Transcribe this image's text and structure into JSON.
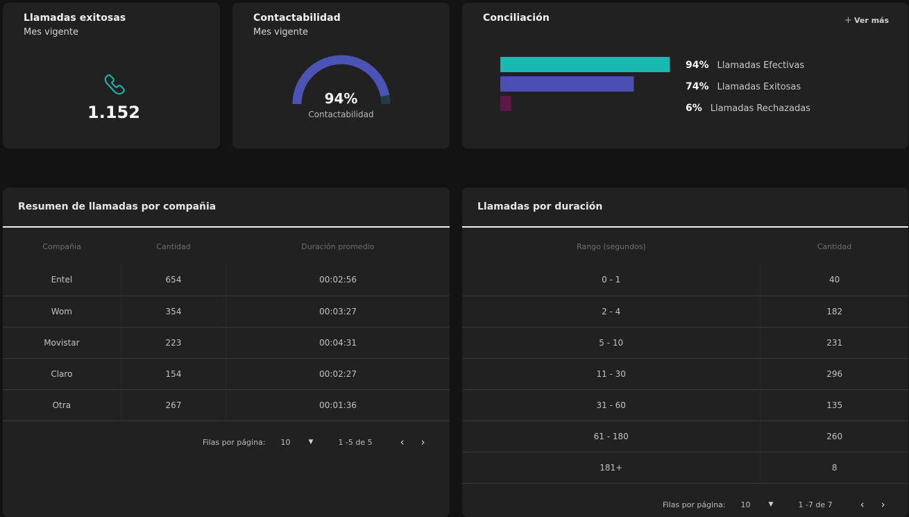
{
  "kpi_calls": {
    "title": "Llamadas exitosas",
    "subtitle": "Mes vigente",
    "icon": "phone-icon",
    "value": "1.152",
    "accent": "#1fb0a8"
  },
  "kpi_contact": {
    "title": "Contactabilidad",
    "subtitle": "Mes vigente",
    "value_text": "94%",
    "value": 94,
    "label": "Contactabilidad",
    "gauge_color": "#4b53b5",
    "gauge_rest_color": "#1e3f49"
  },
  "conciliacion": {
    "title": "Conciliación",
    "ver_mas": "Ver más",
    "items": [
      {
        "value_text": "94%",
        "value": 94,
        "label": "Llamadas Efectivas",
        "color": "#1ab8b0"
      },
      {
        "value_text": "74%",
        "value": 74,
        "label": "Llamadas Exitosas",
        "color": "#4b4fb3"
      },
      {
        "value_text": "6%",
        "value": 6,
        "label": "Llamadas Rechazadas",
        "color": "#5a1a45"
      }
    ]
  },
  "companies": {
    "title": "Resumen de llamadas por compañia",
    "columns": [
      "Compañia",
      "Cantidad",
      "Duración promedio"
    ],
    "rows": [
      [
        "Entel",
        "654",
        "00:02:56"
      ],
      [
        "Wom",
        "354",
        "00:03:27"
      ],
      [
        "Movistar",
        "223",
        "00:04:31"
      ],
      [
        "Claro",
        "154",
        "00:02:27"
      ],
      [
        "Otra",
        "267",
        "00:01:36"
      ]
    ],
    "pager": {
      "rows_label": "Filas por página:",
      "rows_value": "10",
      "range": "1 -5 de 5"
    }
  },
  "durations": {
    "title": "Llamadas por duración",
    "columns": [
      "Rango (segundos)",
      "Cantidad"
    ],
    "rows": [
      [
        "0 - 1",
        "40"
      ],
      [
        "2 - 4",
        "182"
      ],
      [
        "5 - 10",
        "231"
      ],
      [
        "11 - 30",
        "296"
      ],
      [
        "31 - 60",
        "135"
      ],
      [
        "61 - 180",
        "260"
      ],
      [
        "181+",
        "8"
      ]
    ],
    "pager": {
      "rows_label": "Filas por página:",
      "rows_value": "10",
      "range": "1 -7 de 7"
    }
  }
}
